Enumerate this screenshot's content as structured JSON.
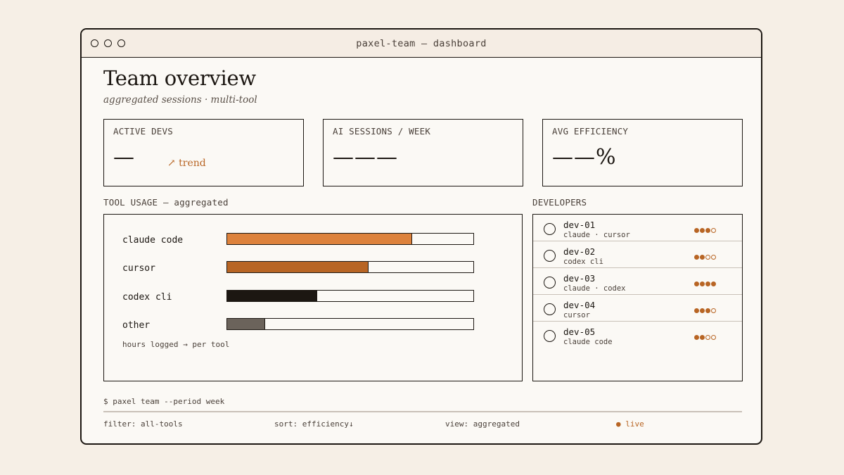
{
  "window": {
    "title": "paxel-team — dashboard"
  },
  "header": {
    "title": "Team overview",
    "subtitle": "aggregated sessions · multi-tool"
  },
  "stats": [
    {
      "label": "ACTIVE DEVS",
      "value": "—",
      "trend": "↗ trend"
    },
    {
      "label": "AI SESSIONS / WEEK",
      "value": "———"
    },
    {
      "label": "AVG EFFICIENCY",
      "value": "——%"
    }
  ],
  "tool_usage": {
    "title": "TOOL USAGE — aggregated",
    "note": "hours logged → per tool",
    "tools": [
      {
        "name": "claude code",
        "fraction": 0.75,
        "color": "#dd823c"
      },
      {
        "name": "cursor",
        "fraction": 0.575,
        "color": "#b86524"
      },
      {
        "name": "codex cli",
        "fraction": 0.365,
        "color": "#1c1712"
      },
      {
        "name": "other",
        "fraction": 0.155,
        "color": "#6b635b"
      }
    ]
  },
  "developers": {
    "title": "DEVELOPERS",
    "items": [
      {
        "name": "dev-01",
        "tools": "claude · cursor",
        "rating": 3,
        "max": 4
      },
      {
        "name": "dev-02",
        "tools": "codex cli",
        "rating": 2,
        "max": 4
      },
      {
        "name": "dev-03",
        "tools": "claude · codex",
        "rating": 4,
        "max": 4
      },
      {
        "name": "dev-04",
        "tools": "cursor",
        "rating": 3,
        "max": 4
      },
      {
        "name": "dev-05",
        "tools": "claude code",
        "rating": 2,
        "max": 4
      }
    ]
  },
  "footer": {
    "command": "$ paxel team --period week",
    "filter": "filter: all-tools",
    "sort": "sort: efficiency↓",
    "view": "view: aggregated",
    "live": "● live"
  }
}
